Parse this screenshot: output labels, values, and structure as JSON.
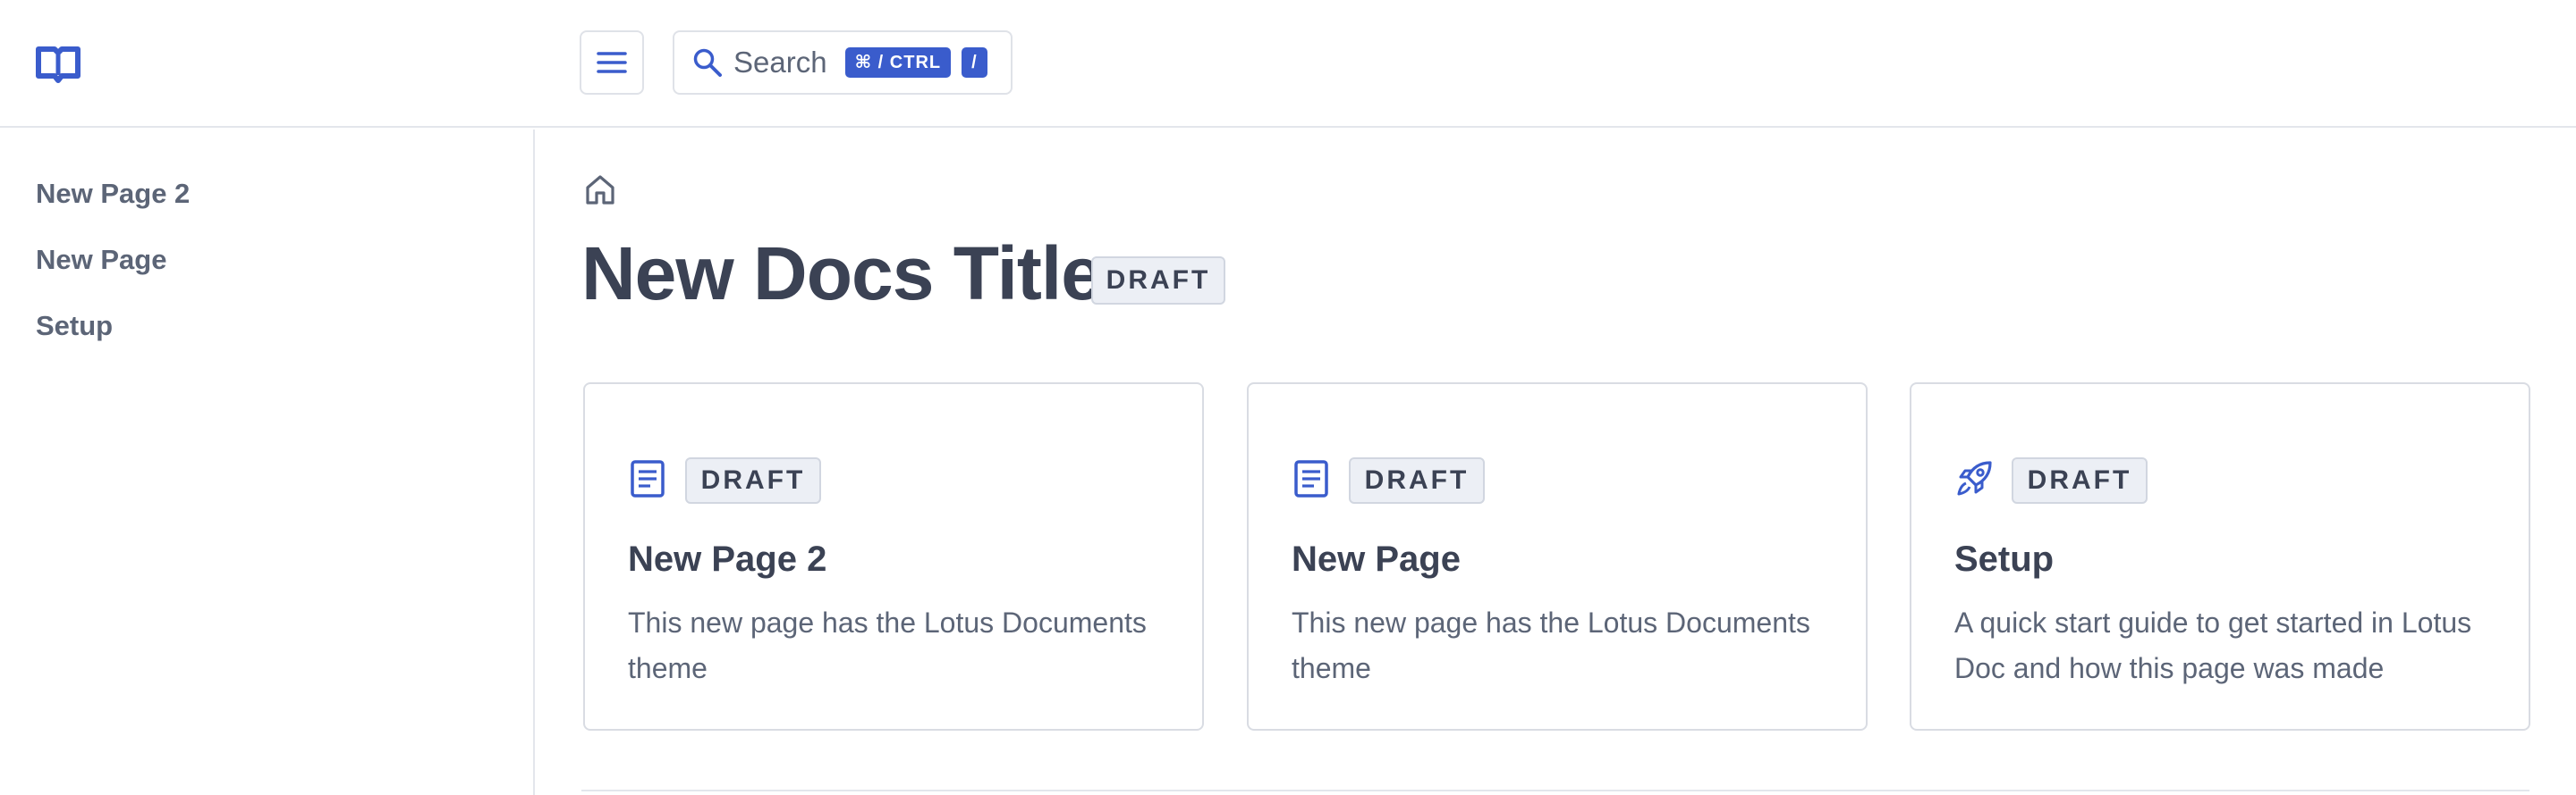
{
  "header": {
    "logo_icon": "open-book-icon",
    "menu_icon": "hamburger-menu-icon",
    "search": {
      "icon": "search-icon",
      "label": "Search",
      "shortcut_modifier": "⌘ / CTRL",
      "shortcut_key": "/"
    }
  },
  "sidebar": {
    "items": [
      {
        "label": "New Page 2"
      },
      {
        "label": "New Page"
      },
      {
        "label": "Setup"
      }
    ]
  },
  "main": {
    "breadcrumb_icon": "home-icon",
    "title": "New Docs Title",
    "title_badge": "DRAFT",
    "cards": [
      {
        "icon": "document-icon",
        "badge": "DRAFT",
        "title": "New Page 2",
        "description": "This new page has the Lotus Documents theme"
      },
      {
        "icon": "document-icon",
        "badge": "DRAFT",
        "title": "New Page",
        "description": "This new page has the Lotus Documents theme"
      },
      {
        "icon": "rocket-icon",
        "badge": "DRAFT",
        "title": "Setup",
        "description": "A quick start guide to get started in Lotus Doc and how this page was made"
      }
    ]
  },
  "colors": {
    "accent": "#3a5ccc",
    "text_primary": "#3b4254",
    "text_secondary": "#5c6577",
    "border": "#e3e6ec",
    "badge_bg": "#eceff5"
  }
}
